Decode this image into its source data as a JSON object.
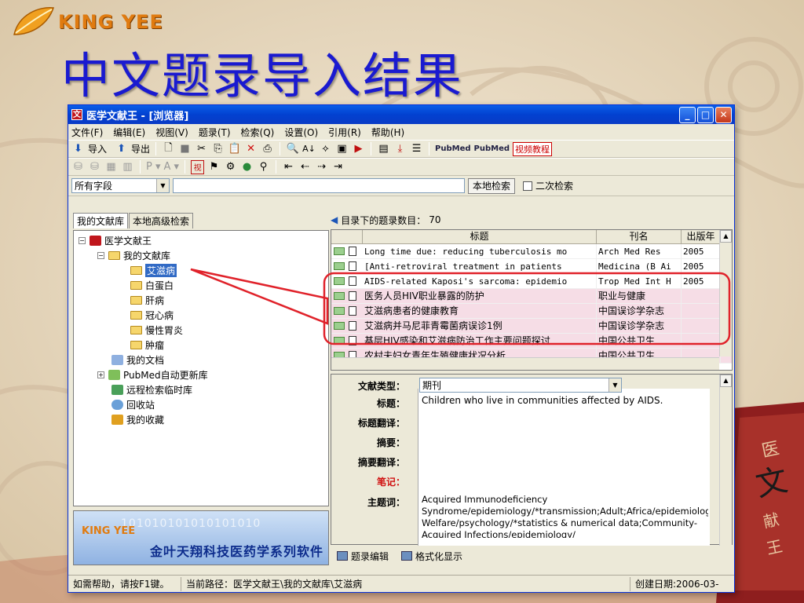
{
  "slide": {
    "brand": "KING YEE",
    "title": "中文题录导入结果",
    "accent_color": "#1a1ad0",
    "brand_color": "#e07b10"
  },
  "window": {
    "title": "医学文献王 - [浏览器]",
    "app_icon_glyph": "文",
    "menu": [
      "文件(F)",
      "编辑(E)",
      "视图(V)",
      "题录(T)",
      "检索(Q)",
      "设置(O)",
      "引用(R)",
      "帮助(H)"
    ],
    "toolbar": {
      "import": "导入",
      "export": "导出",
      "pubmed1": "PubMed",
      "pubmed2": "PubMed",
      "video": "视频教程"
    },
    "search": {
      "field_select": "所有字段",
      "local_search": "本地检索",
      "secondary_search": "二次检索"
    }
  },
  "left_panel": {
    "tabs": [
      "我的文献库",
      "本地高级检索"
    ],
    "tree": {
      "root": "医学文献王",
      "my_library": "我的文献库",
      "folders": [
        "艾滋病",
        "白蛋白",
        "肝病",
        "冠心病",
        "慢性胃炎",
        "肿瘤"
      ],
      "my_docs": "我的文档",
      "pubmed_auto": "PubMed自动更新库",
      "remote_temp": "远程检索临时库",
      "recycle": "回收站",
      "favorites": "我的收藏"
    },
    "banner_slogan": "金叶天翔科技医药学系列软件",
    "banner_bits": "101010101010101010"
  },
  "right_panel": {
    "count_label": "目录下的题录数目：",
    "count_value": "70",
    "columns": [
      "标题",
      "刊名",
      "出版年"
    ],
    "rows": [
      {
        "title": "Long time due: reducing tuberculosis mo",
        "journal": "Arch Med Res",
        "year": "2005",
        "highlight": false
      },
      {
        "title": "[Anti-retroviral treatment in patients",
        "journal": "Medicina (B Ai",
        "year": "2005",
        "highlight": false
      },
      {
        "title": "AIDS-related Kaposi's sarcoma: epidemio",
        "journal": "Trop Med Int H",
        "year": "2005",
        "highlight": false
      },
      {
        "title": "医务人员HIV职业暴露的防护",
        "journal": "职业与健康",
        "year": "",
        "highlight": true
      },
      {
        "title": "艾滋病患者的健康教育",
        "journal": "中国误诊学杂志",
        "year": "",
        "highlight": true
      },
      {
        "title": "艾滋病并马尼菲青霉菌病误诊1例",
        "journal": "中国误诊学杂志",
        "year": "",
        "highlight": true
      },
      {
        "title": "基层HIV感染和艾滋病防治工作主要问题探讨",
        "journal": "中国公共卫生",
        "year": "",
        "highlight": true
      },
      {
        "title": "农村夫妇女青年生殖健康状况分析",
        "journal": "中国公共卫生",
        "year": "",
        "highlight": true
      }
    ],
    "detail": {
      "doc_type_label": "文献类型：",
      "doc_type_value": "期刊",
      "title_label": "标题：",
      "title_value": "Children who live in communities affected by AIDS.",
      "title_trans_label": "标题翻译：",
      "abstract_label": "摘要：",
      "abstract_trans_label": "摘要翻译：",
      "notes_label": "笔记：",
      "keywords_label": "主题词：",
      "keywords_value": "Acquired Immunodeficiency Syndrome/epidemiology/*transmission;Adult;Africa/epidemiology;Child;Child Welfare/psychology/*statistics & numerical data;Community-Acquired Infections/epidemiology/"
    },
    "bottom_tabs": [
      "题录编辑",
      "格式化显示"
    ]
  },
  "statusbar": {
    "help": "如需帮助，请按F1键。",
    "path": "当前路径：医学文献王\\我的文献库\\艾滋病",
    "created": "创建日期:2006-03-"
  },
  "highlight_color": "#e0222a"
}
